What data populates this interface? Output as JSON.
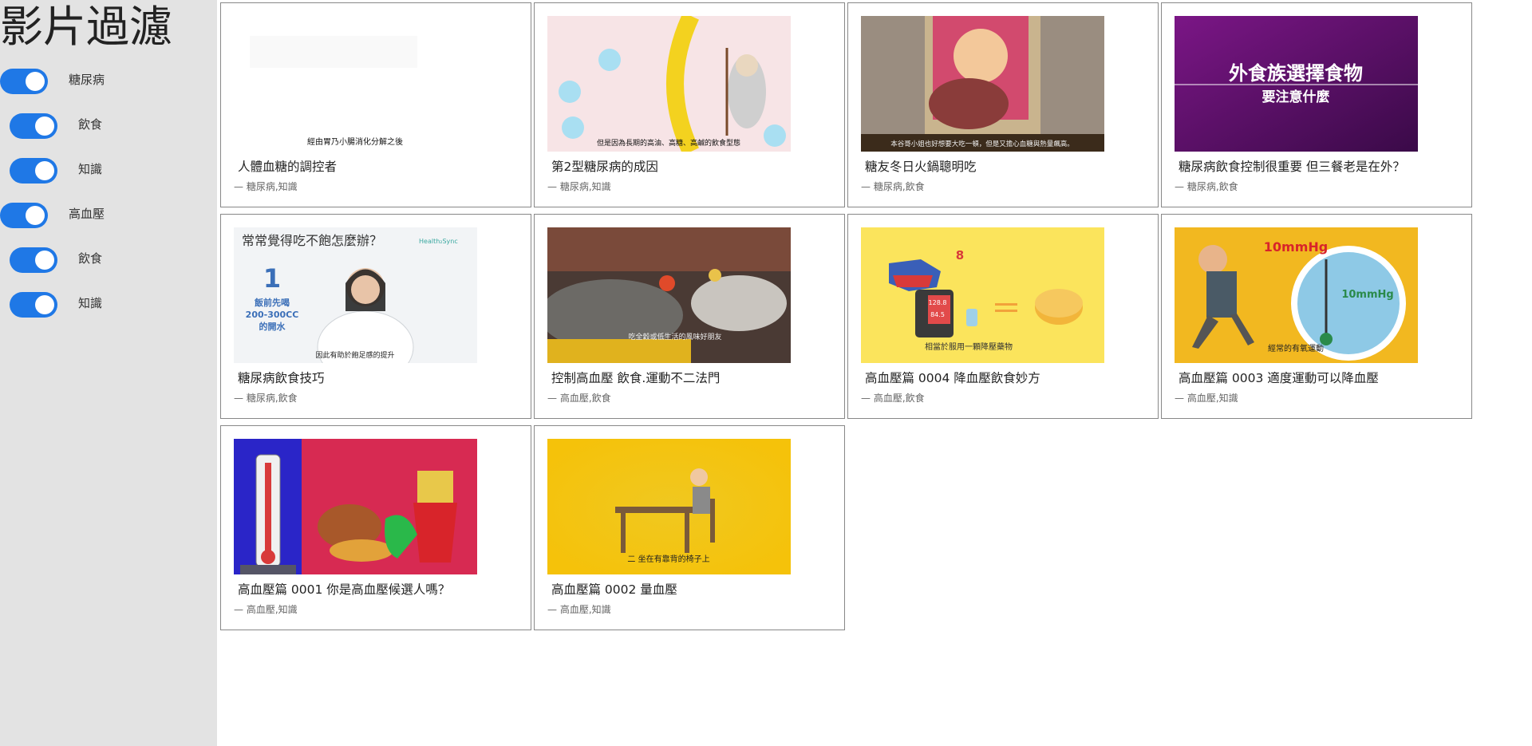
{
  "sidebar": {
    "title": "影片過濾",
    "filters": [
      {
        "label": "糖尿病",
        "on": true
      },
      {
        "label": "飲食",
        "on": true
      },
      {
        "label": "知識",
        "on": true
      },
      {
        "label": "高血壓",
        "on": true
      },
      {
        "label": "飲食",
        "on": true
      },
      {
        "label": "知識",
        "on": true
      }
    ]
  },
  "videos": [
    {
      "title": "人體血糖的調控者",
      "tags": "— 糖尿病,知識",
      "caption": "經由胃乃小腸消化分解之後"
    },
    {
      "title": "第2型糖尿病的成因",
      "tags": "— 糖尿病,知識",
      "caption": "但是因為長期的高油、高糖、高鹹的飲食型態"
    },
    {
      "title": "糖友冬日火鍋聰明吃",
      "tags": "— 糖尿病,飲食",
      "caption": "本谷哥小姐也好想要大吃一頓，但是又擔心血糖與熱量飆高。"
    },
    {
      "title": "糖尿病飲食控制很重要 但三餐老是在外？",
      "tags": "— 糖尿病,飲食",
      "caption": "外食族選擇食物",
      "caption2": "要注意什麼"
    },
    {
      "title": "糖尿病飲食技巧",
      "tags": "— 糖尿病,飲食",
      "caption": "常常覺得吃不飽怎麼辦？",
      "caption2": "飯前先喝",
      "caption3": "200-300CC",
      "caption4": "的開水",
      "caption5": "因此有助於飽足感的提升",
      "number": "1",
      "logo": "Health₂Sync"
    },
    {
      "title": "控制高血壓 飲食.運動不二法門",
      "tags": "— 高血壓,飲食",
      "caption": "吃全穀或低生活的風味好朋友"
    },
    {
      "title": "高血壓篇 0004 降血壓飲食妙方",
      "tags": "— 高血壓,飲食",
      "caption": "相當於服用一顆降壓藥物",
      "reading1": "128.8",
      "reading2": "84.5",
      "badge": "8"
    },
    {
      "title": "高血壓篇 0003 適度運動可以降血壓",
      "tags": "— 高血壓,知識",
      "caption": "經常的有氧運動",
      "caption2": "10mmHg"
    },
    {
      "title": "高血壓篇 0001 你是高血壓候選人嗎？",
      "tags": "— 高血壓,知識"
    },
    {
      "title": "高血壓篇 0002 量血壓",
      "tags": "— 高血壓,知識",
      "caption": "二 坐在有靠背的椅子上"
    }
  ],
  "colors": {
    "accent": "#1f78e6",
    "sidebar_bg": "#e3e3e3",
    "card_border": "#888888"
  }
}
